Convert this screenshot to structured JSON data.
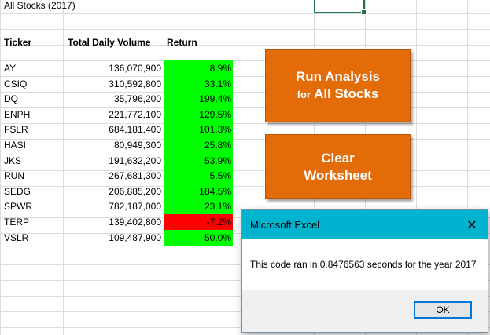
{
  "sheet": {
    "title": "All Stocks (2017)",
    "headers": {
      "ticker": "Ticker",
      "volume": "Total Daily Volume",
      "return": "Return"
    },
    "rows": [
      {
        "ticker": "AY",
        "volume": "136,070,900",
        "return": "8.9%",
        "status": "positive"
      },
      {
        "ticker": "CSIQ",
        "volume": "310,592,800",
        "return": "33.1%",
        "status": "positive"
      },
      {
        "ticker": "DQ",
        "volume": "35,796,200",
        "return": "199.4%",
        "status": "positive"
      },
      {
        "ticker": "ENPH",
        "volume": "221,772,100",
        "return": "129.5%",
        "status": "positive"
      },
      {
        "ticker": "FSLR",
        "volume": "684,181,400",
        "return": "101.3%",
        "status": "positive"
      },
      {
        "ticker": "HASI",
        "volume": "80,949,300",
        "return": "25.8%",
        "status": "positive"
      },
      {
        "ticker": "JKS",
        "volume": "191,632,200",
        "return": "53.9%",
        "status": "positive"
      },
      {
        "ticker": "RUN",
        "volume": "267,681,300",
        "return": "5.5%",
        "status": "positive"
      },
      {
        "ticker": "SEDG",
        "volume": "206,885,200",
        "return": "184.5%",
        "status": "positive"
      },
      {
        "ticker": "SPWR",
        "volume": "782,187,000",
        "return": "23.1%",
        "status": "positive"
      },
      {
        "ticker": "TERP",
        "volume": "139,402,800",
        "return": "-7.2%",
        "status": "negative"
      },
      {
        "ticker": "VSLR",
        "volume": "109,487,900",
        "return": "50.0%",
        "status": "positive"
      }
    ]
  },
  "buttons": {
    "run_line1": "Run Analysis",
    "run_line2_prefix": "for",
    "run_line2_main": "All Stocks",
    "clear_line1": "Clear",
    "clear_line2": "Worksheet"
  },
  "dialog": {
    "title": "Microsoft Excel",
    "close": "✕",
    "message": "This code ran in 0.8476563 seconds for the year 2017",
    "ok": "OK"
  },
  "colors": {
    "positive": "#00ff00",
    "negative": "#ff0000",
    "button": "#e36c09",
    "dialog_title": "#00b4d0"
  }
}
